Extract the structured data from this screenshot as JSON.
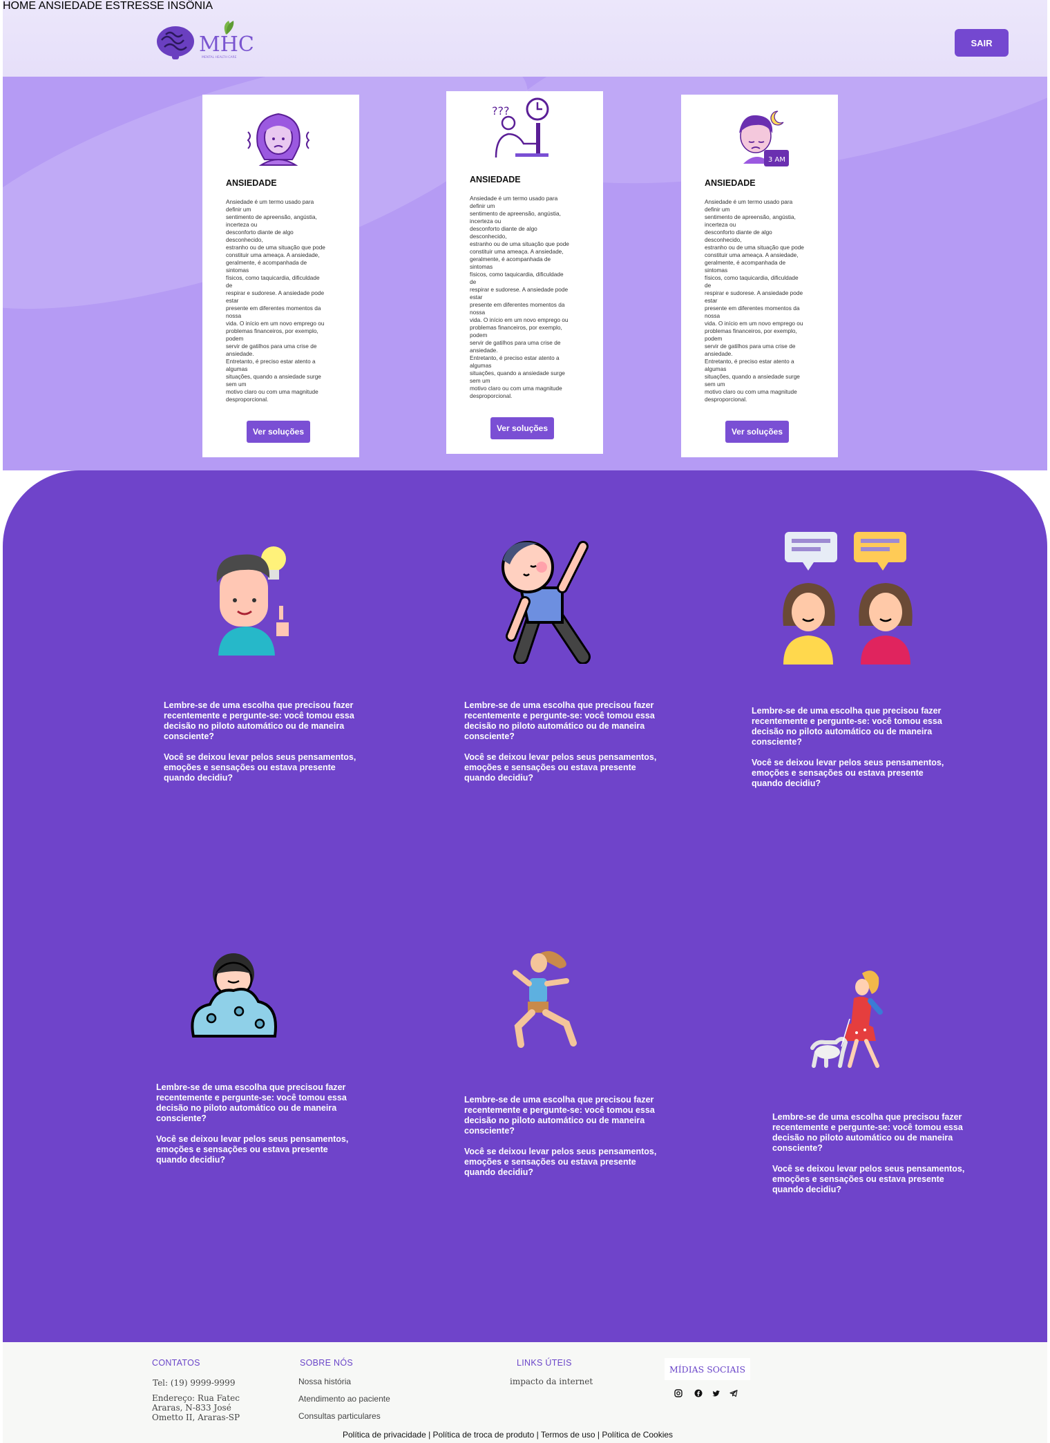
{
  "header": {
    "logo_text": "MHC",
    "logo_tagline": "MENTAL HEALTH CARE",
    "nav": [
      "HOME",
      "ANSIEDADE",
      "ESTRESSE",
      "INSÔNIA"
    ],
    "logout_label": "SAIR"
  },
  "cards": [
    {
      "title": "ANSIEDADE",
      "body": "Ansiedade é um termo  usado para\ndefinir um\nsentimento de apreensão, angústia,\nincerteza ou\ndesconforto diante  de algo\ndesconhecido,\nestranho ou de uma situação que pode\nconstituir uma ameaça. A ansiedade,\ngeralmente, é acompanhada de\nsintomas\nfísicos, como taquicardia, dificuldade\nde\nrespirar e sudorese. A ansiedade pode\nestar\npresente em diferentes momentos da\nnossa\nvida.  O início em um novo emprego ou\nproblemas financeiros,  por exemplo,\npodem\nservir de gatilhos para uma crise de\nansiedade.\nEntretanto, é preciso  estar atento a\nalgumas\nsituações, quando  a ansiedade surge\nsem um\nmotivo claro ou com  uma magnitude\ndesproporcional.",
      "button": "Ver soluções",
      "icon": "anxious-woman-icon"
    },
    {
      "title": "ANSIEDADE",
      "body": "Ansiedade é um termo  usado para\ndefinir um\nsentimento de apreensão, angústia,\nincerteza ou\ndesconforto diante  de algo\ndesconhecido,\nestranho ou de uma situação que pode\nconstituir uma ameaça. A ansiedade,\ngeralmente, é acompanhada de\nsintomas\nfísicos, como taquicardia, dificuldade\nde\nrespirar e sudorese. A ansiedade pode\nestar\npresente em diferentes momentos da\nnossa\nvida.  O início em um novo emprego ou\nproblemas financeiros,  por exemplo,\npodem\nservir de gatilhos para uma crise de\nansiedade.\nEntretanto, é preciso  estar atento a\nalgumas\nsituações, quando  a ansiedade surge\nsem um\nmotivo claro ou com  uma magnitude\ndesproporcional.",
      "button": "Ver soluções",
      "icon": "worried-worker-clock-icon"
    },
    {
      "title": "ANSIEDADE",
      "body": "Ansiedade é um termo  usado para\ndefinir um\nsentimento de apreensão, angústia,\nincerteza ou\ndesconforto diante  de algo\ndesconhecido,\nestranho ou de uma situação que pode\nconstituir uma ameaça. A ansiedade,\ngeralmente, é acompanhada de\nsintomas\nfísicos, como taquicardia, dificuldade\nde\nrespirar e sudorese. A ansiedade pode\nestar\npresente em diferentes momentos da\nnossa\nvida.  O início em um novo emprego ou\nproblemas financeiros,  por exemplo,\npodem\nservir de gatilhos para uma crise de\nansiedade.\nEntretanto, é preciso  estar atento a\nalgumas\nsituações, quando  a ansiedade surge\nsem um\nmotivo claro ou com  uma magnitude\ndesproporcional.",
      "button": "Ver soluções",
      "icon": "sleepless-man-3am-icon",
      "badge": "3 AM"
    }
  ],
  "tips": [
    {
      "p1": "Lembre-se de uma escolha que precisou fazer recentemente e pergunte-se: você tomou essa decisão no piloto automático ou de maneira consciente?",
      "p2": "Você se deixou levar pelos seus pensamentos, emoções e sensações ou estava presente quando decidiu?",
      "illustration": "man-lightbulb-illustration"
    },
    {
      "p1": "Lembre-se de uma escolha que precisou fazer recentemente e pergunte-se: você tomou essa decisão no piloto automático ou de maneira consciente?",
      "p2": "Você se deixou levar pelos seus pensamentos, emoções e sensações ou estava presente quando decidiu?",
      "illustration": "stretching-person-illustration"
    },
    {
      "p1": "Lembre-se de uma escolha que precisou fazer recentemente e pergunte-se: você tomou essa decisão no piloto automático ou de maneira consciente?",
      "p2": "Você se deixou levar pelos seus pensamentos, emoções e sensações ou estava presente quando decidiu?",
      "illustration": "two-women-talking-illustration"
    },
    {
      "p1": "Lembre-se de uma escolha que precisou fazer recentemente e pergunte-se: você tomou essa decisão no piloto automático ou de maneira consciente?",
      "p2": "Você se deixou levar pelos seus pensamentos, emoções e sensações ou estava presente quando decidiu?",
      "illustration": "person-bubble-bath-illustration"
    },
    {
      "p1": "Lembre-se de uma escolha que precisou fazer recentemente e pergunte-se: você tomou essa decisão no piloto automático ou de maneira consciente?",
      "p2": "Você se deixou levar pelos seus pensamentos, emoções e sensações ou estava presente quando decidiu?",
      "illustration": "running-woman-illustration"
    },
    {
      "p1": "Lembre-se de uma escolha que precisou fazer recentemente e pergunte-se: você tomou essa decisão no piloto automático ou de maneira consciente?",
      "p2": "Você se deixou levar pelos seus pensamentos, emoções e sensações ou estava presente quando decidiu?",
      "illustration": "woman-walking-dog-illustration"
    }
  ],
  "footer": {
    "contatos": {
      "title": "CONTATOS",
      "tel": "Tel:  (19) 9999-9999",
      "address": "Endereço: Rua Fatec\nAraras, N-833 José\nOmetto II, Araras-SP"
    },
    "sobre": {
      "title": "SOBRE NÓS",
      "links": [
        "Nossa história",
        "Atendimento ao paciente",
        "Consultas particulares"
      ]
    },
    "links": {
      "title": "LINKS ÚTEIS",
      "items": [
        "impacto da internet"
      ]
    },
    "midias": {
      "title": "MÍDIAS SOCIAIS",
      "icons": [
        "instagram-icon",
        "facebook-icon",
        "twitter-icon",
        "telegram-icon"
      ]
    },
    "policies": "Política de privacidade | Política de troca  de produto |  Termos de uso | Política de Cookies"
  },
  "colors": {
    "brand": "#6f44ca",
    "band": "#b59bf4",
    "button": "#7a4fd4",
    "header": "#ece7fb"
  }
}
